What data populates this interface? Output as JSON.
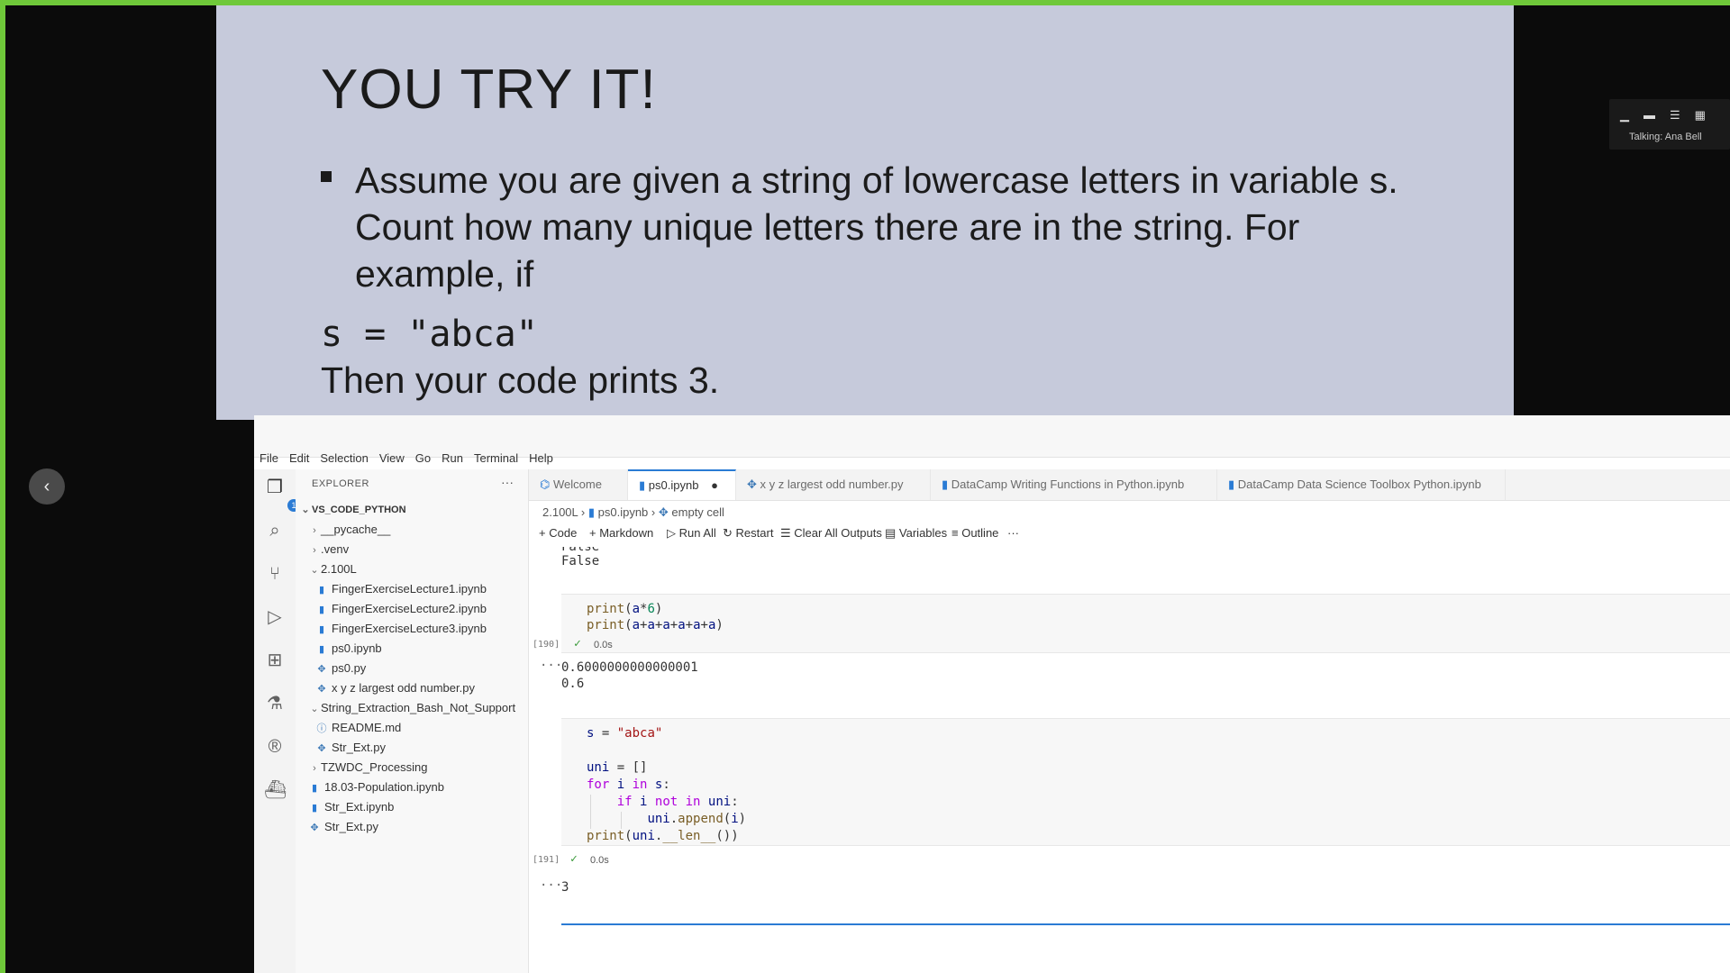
{
  "slide": {
    "title": "YOU TRY IT!",
    "bullet_lines": [
      "Assume you are given a string of lowercase letters in variable s.",
      "Count how many unique letters there are in the string. For",
      "example, if"
    ],
    "code": "s = \"abca\"",
    "then": "Then your code prints 3."
  },
  "meeting": {
    "talking": "Talking: Ana Bell"
  },
  "vscode": {
    "menu": [
      "File",
      "Edit",
      "Selection",
      "View",
      "Go",
      "Run",
      "Terminal",
      "Help"
    ],
    "explorer": {
      "title": "EXPLORER",
      "more": "···",
      "root": "VS_CODE_PYTHON",
      "items": [
        {
          "label": "__pycache__",
          "indent": 1,
          "type": "folder",
          "expanded": false
        },
        {
          "label": ".venv",
          "indent": 1,
          "type": "folder",
          "expanded": false
        },
        {
          "label": "2.100L",
          "indent": 1,
          "type": "folder",
          "expanded": true
        },
        {
          "label": "FingerExerciseLecture1.ipynb",
          "indent": 2,
          "type": "notebook"
        },
        {
          "label": "FingerExerciseLecture2.ipynb",
          "indent": 2,
          "type": "notebook"
        },
        {
          "label": "FingerExerciseLecture3.ipynb",
          "indent": 2,
          "type": "notebook"
        },
        {
          "label": "ps0.ipynb",
          "indent": 2,
          "type": "notebook"
        },
        {
          "label": "ps0.py",
          "indent": 2,
          "type": "python"
        },
        {
          "label": "x y z largest odd number.py",
          "indent": 2,
          "type": "python"
        },
        {
          "label": "String_Extraction_Bash_Not_Support",
          "indent": 1,
          "type": "folder",
          "expanded": true
        },
        {
          "label": "README.md",
          "indent": 2,
          "type": "info"
        },
        {
          "label": "Str_Ext.py",
          "indent": 2,
          "type": "python"
        },
        {
          "label": "TZWDC_Processing",
          "indent": 1,
          "type": "folder",
          "expanded": false
        },
        {
          "label": "18.03-Population.ipynb",
          "indent": 1,
          "type": "notebook"
        },
        {
          "label": "Str_Ext.ipynb",
          "indent": 1,
          "type": "notebook"
        },
        {
          "label": "Str_Ext.py",
          "indent": 1,
          "type": "python"
        }
      ]
    },
    "tabs": [
      {
        "label": "Welcome"
      },
      {
        "label": "ps0.ipynb"
      },
      {
        "label": "x y z largest odd number.py"
      },
      {
        "label": "DataCamp Writing Functions in Python.ipynb"
      },
      {
        "label": "DataCamp Data Science Toolbox Python.ipynb"
      }
    ],
    "breadcrumb": [
      "2.100L",
      "ps0.ipynb",
      "empty cell"
    ],
    "toolbar": {
      "code": "Code",
      "markdown": "Markdown",
      "run_all": "Run All",
      "restart": "Restart",
      "clear": "Clear All Outputs",
      "variables": "Variables",
      "outline": "Outline",
      "more": "···"
    },
    "notebook": {
      "prev_output": [
        "False",
        "False"
      ],
      "cell1": {
        "lines": [
          "print(a*6)",
          "print(a+a+a+a+a+a)"
        ],
        "exec_count": "[190]",
        "duration": "0.0s",
        "output": [
          "0.6000000000000001",
          "0.6"
        ]
      },
      "cell2": {
        "lines": [
          "s = \"abca\"",
          "",
          "uni = []",
          "for i in s:",
          "    if i not in uni:",
          "        uni.append(i)",
          "print(uni.__len__())"
        ],
        "exec_count": "[191]",
        "duration": "0.0s",
        "output": [
          "3"
        ]
      },
      "output_dots": "···"
    }
  }
}
